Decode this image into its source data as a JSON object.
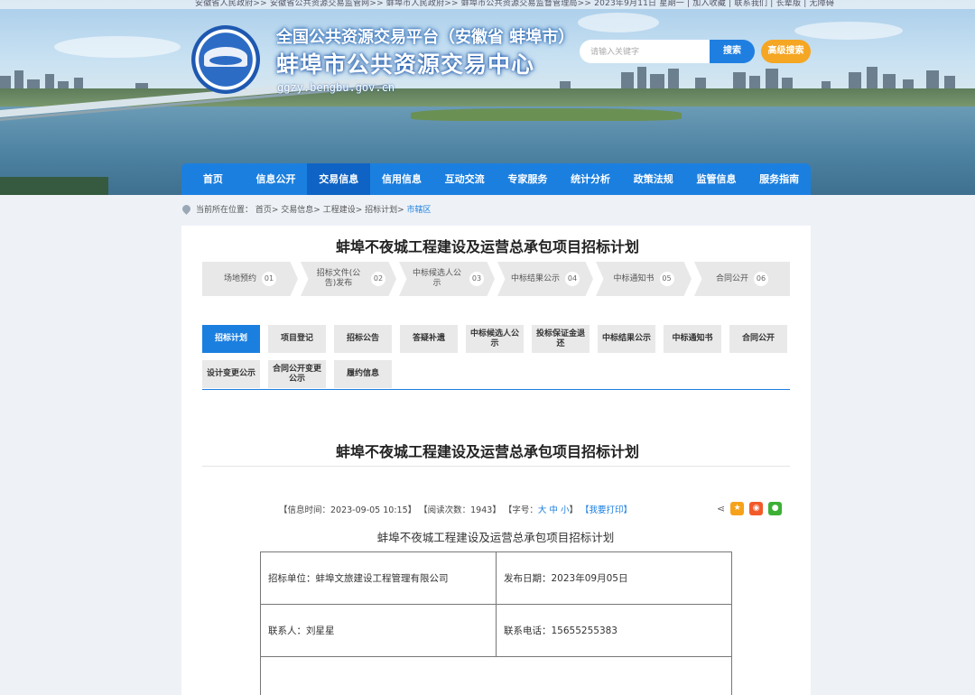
{
  "topbar": {
    "text": "安徽省人民政府>>   安徽省公共资源交易监管网>>   蚌埠市人民政府>>   蚌埠市公共资源交易监督管理局>>   2023年9月11日 星期一 | 加入收藏 | 联系我们 | 长辈版 | 无障碍"
  },
  "header": {
    "subtitle": "全国公共资源交易平台（安徽省 蚌埠市）",
    "title": "蚌埠市公共资源交易中心",
    "domain": "ggzy.bengbu.gov.cn"
  },
  "search": {
    "placeholder": "请输入关键字",
    "button_label": "搜索",
    "advanced_label": "高级搜索"
  },
  "nav": {
    "items": [
      {
        "label": "首页"
      },
      {
        "label": "信息公开"
      },
      {
        "label": "交易信息"
      },
      {
        "label": "信用信息"
      },
      {
        "label": "互动交流"
      },
      {
        "label": "专家服务"
      },
      {
        "label": "统计分析"
      },
      {
        "label": "政策法规"
      },
      {
        "label": "监管信息"
      },
      {
        "label": "服务指南"
      }
    ],
    "active_index": 2
  },
  "breadcrumb": {
    "prefix": "当前所在位置：",
    "path": "首页> 交易信息> 工程建设> 招标计划>",
    "current": " 市辖区"
  },
  "plan": {
    "title": "蚌埠不夜城工程建设及运营总承包项目招标计划"
  },
  "steps": [
    {
      "label": "场地预约",
      "num": "01"
    },
    {
      "label": "招标文件(公告)发布",
      "num": "02"
    },
    {
      "label": "中标候选人公示",
      "num": "03"
    },
    {
      "label": "中标结果公示",
      "num": "04"
    },
    {
      "label": "中标通知书",
      "num": "05"
    },
    {
      "label": "合同公开",
      "num": "06"
    }
  ],
  "tabs": {
    "row1": [
      {
        "label": "招标计划"
      },
      {
        "label": "项目登记"
      },
      {
        "label": "招标公告"
      },
      {
        "label": "答疑补遗"
      },
      {
        "label": "中标候选人公示"
      },
      {
        "label": "投标保证金退还"
      },
      {
        "label": "中标结果公示"
      },
      {
        "label": "中标通知书"
      },
      {
        "label": "合同公开"
      }
    ],
    "row2": [
      {
        "label": "设计变更公示"
      },
      {
        "label": "合同公开变更公示"
      },
      {
        "label": "履约信息"
      }
    ],
    "active": "招标计划"
  },
  "article": {
    "title": "蚌埠不夜城工程建设及运营总承包项目招标计划",
    "meta_time": "【信息时间：2023-09-05 10:15】",
    "meta_reads": "【阅读次数：1943】",
    "meta_font_prefix": "【字号：",
    "font_large": "大",
    "font_medium": "中",
    "font_small": "小",
    "meta_font_suffix": "】",
    "print_label": "【我要打印】",
    "doc_heading": "蚌埠不夜城工程建设及运营总承包项目招标计划"
  },
  "share": {
    "icons": [
      "share-icon",
      "qzone-icon",
      "weibo-icon",
      "wechat-icon"
    ],
    "colors": {
      "qzone": "#f7a21b",
      "weibo": "#f25a2a",
      "wechat": "#3cb035"
    }
  },
  "info_table": {
    "tenderer": "招标单位：蚌埠文旅建设工程管理有限公司",
    "publish_date": "发布日期：2023年09月05日",
    "contact": "联系人：刘星星",
    "phone": "联系电话：15655255383"
  },
  "colors": {
    "primary": "#1b7fe0",
    "active_nav": "#0f63c4",
    "accent_orange": "#f5a623"
  }
}
